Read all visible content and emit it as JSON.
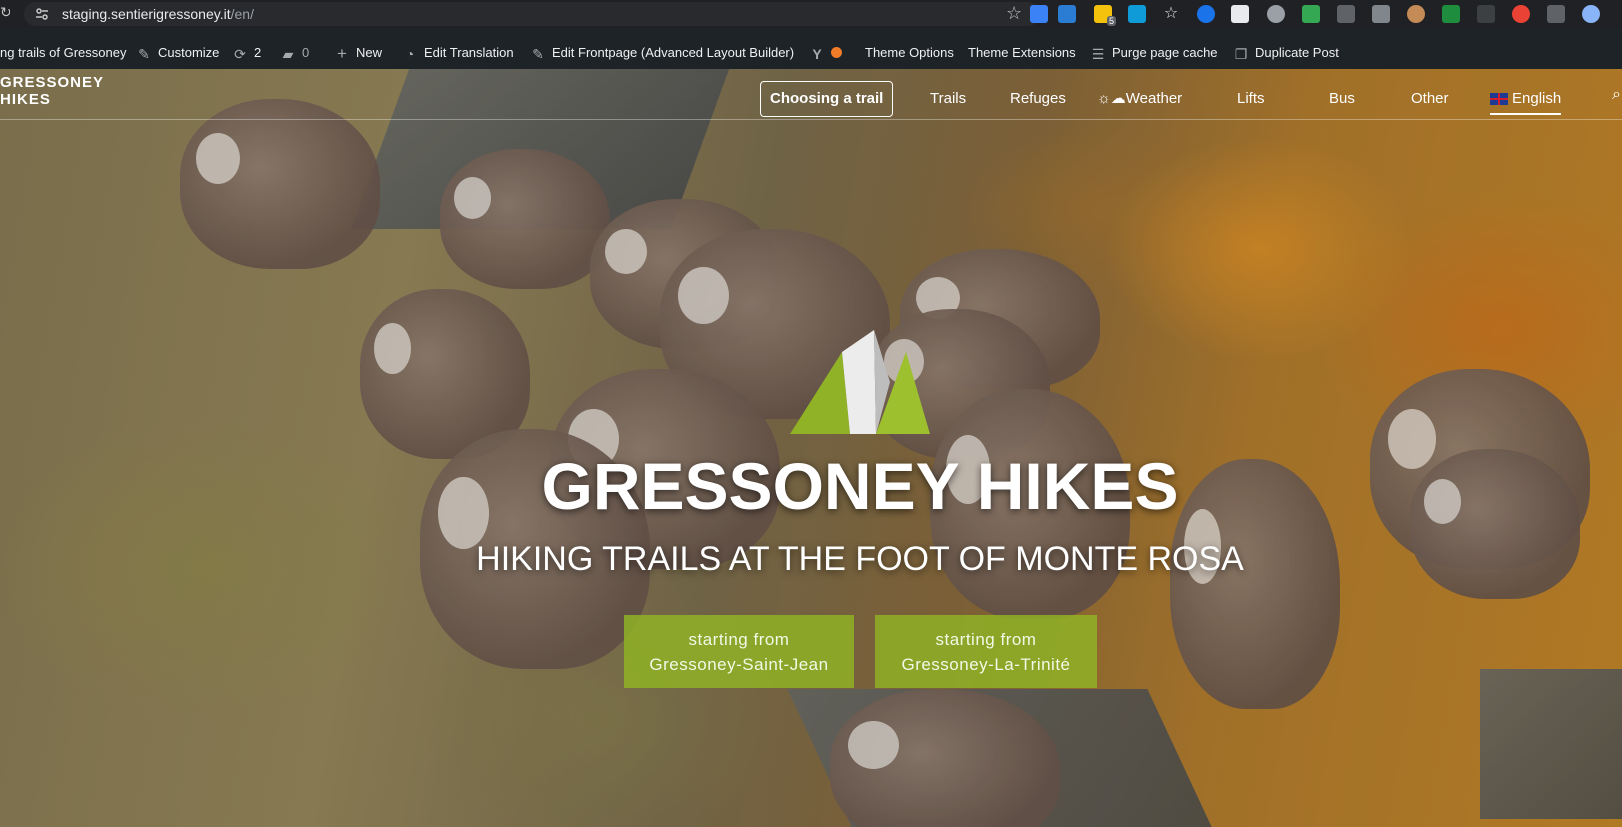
{
  "browser": {
    "url_host": "staging.sentierigressoney.it",
    "url_path": "/en/",
    "extension_badge": "5"
  },
  "admin_bar": {
    "site_name": "ng trails of Gressoney",
    "customize": "Customize",
    "updates_count": "2",
    "comments_count": "0",
    "new": "New",
    "edit_translation": "Edit Translation",
    "edit_frontpage": "Edit Frontpage (Advanced Layout Builder)",
    "yoast_icon": "Y",
    "theme_options": "Theme Options",
    "theme_extensions": "Theme Extensions",
    "purge_cache": "Purge page cache",
    "duplicate_post": "Duplicate Post"
  },
  "header": {
    "logo_line1": "GRESSONEY",
    "logo_line2": "HIKES",
    "nav": {
      "choosing": "Choosing a trail",
      "trails": "Trails",
      "refuges": "Refuges",
      "weather": "Weather",
      "lifts": "Lifts",
      "bus": "Bus",
      "other": "Other",
      "language": "English"
    }
  },
  "hero": {
    "title": "GRESSONEY HIKES",
    "subtitle": "HIKING TRAILS AT THE FOOT OF MONTE ROSA",
    "cta_left_line1": "starting from",
    "cta_left_line2": "Gressoney-Saint-Jean",
    "cta_right_line1": "starting from",
    "cta_right_line2": "Gressoney-La-Trinité"
  },
  "colors": {
    "accent_green": "#8fb226",
    "admin_bar": "#1d2327",
    "browser_chrome": "#202124"
  }
}
